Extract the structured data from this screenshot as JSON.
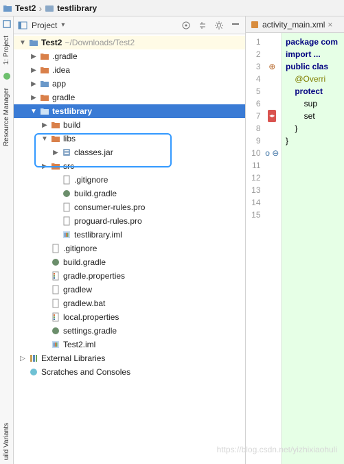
{
  "breadcrumb": {
    "root": "Test2",
    "child": "testlibrary"
  },
  "left_rail": {
    "t1": "1: Project",
    "t2": "Resource Manager",
    "t3": "uild Variants"
  },
  "panel": {
    "title": "Project",
    "arrow": "▾"
  },
  "tree": {
    "rootLabel": "Test2",
    "rootPath": "~/Downloads/Test2",
    "dot_gradle": ".gradle",
    "dot_idea": ".idea",
    "app": "app",
    "gradle": "gradle",
    "testlibrary": "testlibrary",
    "build": "build",
    "libs": "libs",
    "classes_jar": "classes.jar",
    "src": "src",
    "gitignore": ".gitignore",
    "build_gradle": "build.gradle",
    "consumer_rules": "consumer-rules.pro",
    "proguard_rules": "proguard-rules.pro",
    "testlibrary_iml": "testlibrary.iml",
    "root_gitignore": ".gitignore",
    "root_build_gradle": "build.gradle",
    "gradle_properties": "gradle.properties",
    "gradlew": "gradlew",
    "gradlew_bat": "gradlew.bat",
    "local_properties": "local.properties",
    "settings_gradle": "settings.gradle",
    "test2_iml": "Test2.iml",
    "external_libs": "External Libraries",
    "scratches": "Scratches and Consoles"
  },
  "editor": {
    "tab_name": "activity_main.xml",
    "lines": {
      "l1": "package com",
      "l2": "",
      "l3": "import ...",
      "l4": "",
      "l5": "public clas",
      "l6": "",
      "l7": "    @Overri",
      "l8": "    protect",
      "l9": "        sup",
      "l10": "        set",
      "l11": "    }",
      "l12": "}",
      "l13": ""
    },
    "linenums": [
      "1",
      "2",
      "3",
      "4",
      "5",
      "6",
      "7",
      "8",
      "9",
      "10",
      "11",
      "12",
      "13",
      "14",
      "15"
    ]
  },
  "watermark": "https://blog.csdn.net/yizhixiaohuli"
}
